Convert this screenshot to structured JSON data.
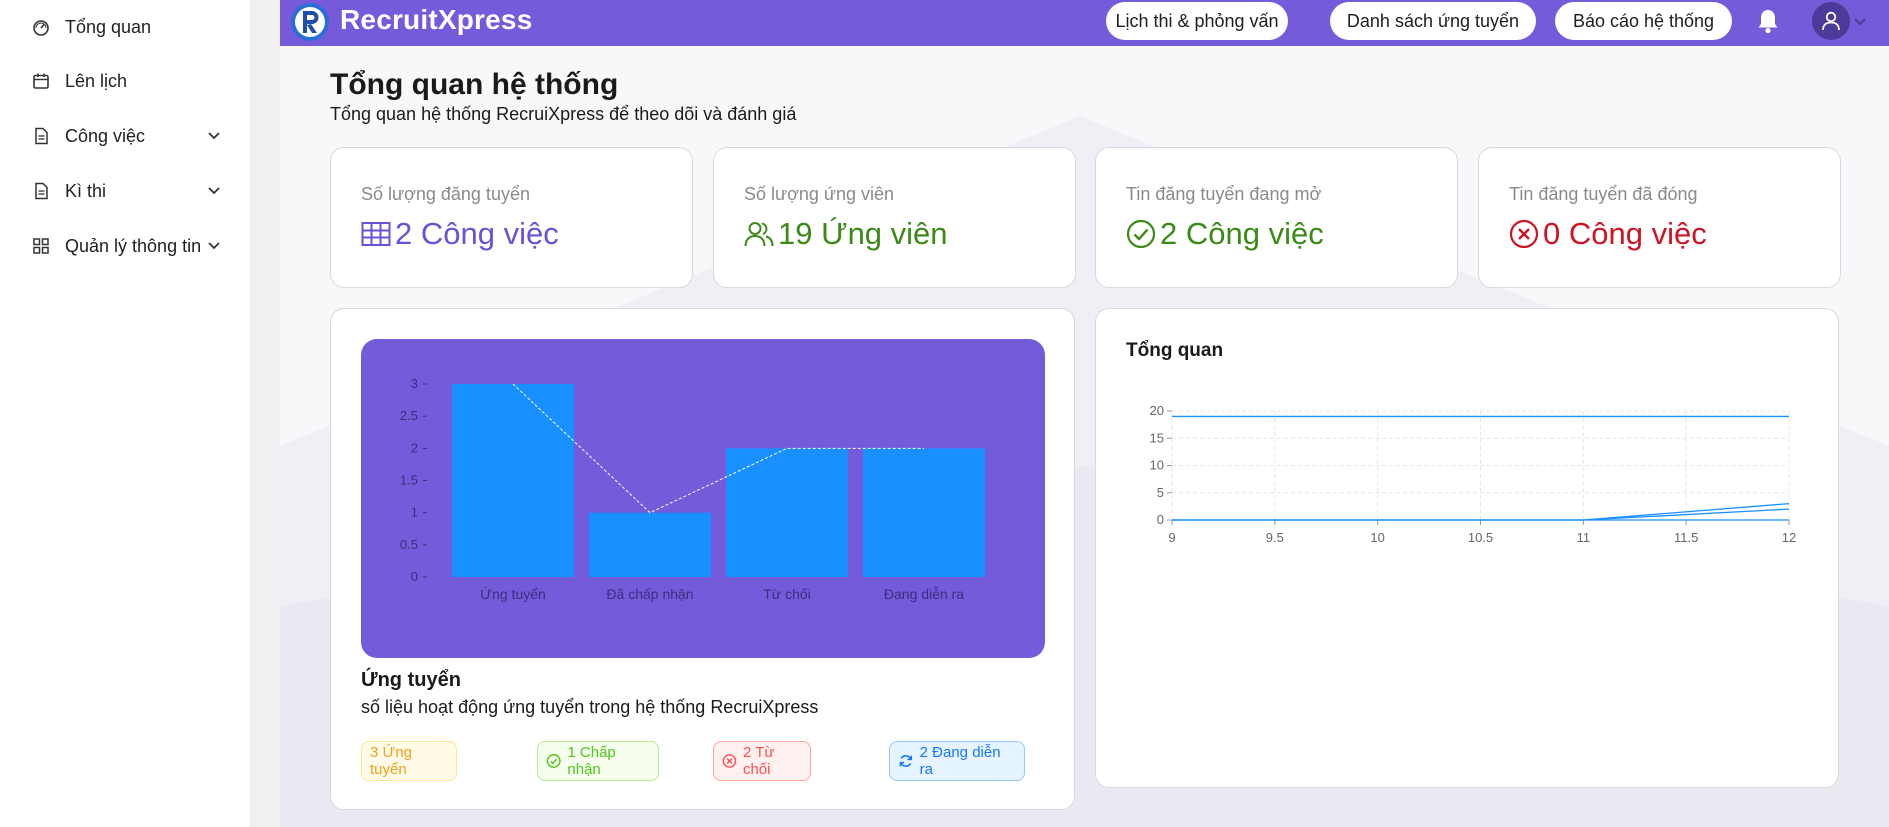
{
  "app": {
    "brand": "RecruitXpress"
  },
  "sidebar": {
    "items": [
      {
        "label": "Tổng quan",
        "icon": "dashboard-icon",
        "has_submenu": false
      },
      {
        "label": "Lên lịch",
        "icon": "calendar-icon",
        "has_submenu": false
      },
      {
        "label": "Công việc",
        "icon": "document-icon",
        "has_submenu": true
      },
      {
        "label": "Kì thi",
        "icon": "document-icon",
        "has_submenu": true
      },
      {
        "label": "Quản lý thông tin",
        "icon": "grid-icon",
        "has_submenu": true
      }
    ]
  },
  "header": {
    "nav": [
      "Lịch thi & phỏng vấn",
      "Danh sách ứng tuyển",
      "Báo cáo hệ thống"
    ],
    "icons": [
      "bell-icon",
      "user-icon",
      "chevron-down-icon"
    ]
  },
  "page": {
    "title": "Tổng quan hệ thống",
    "subtitle": "Tổng quan hệ thống RecruiXpress để theo dõi và đánh giá"
  },
  "stats": [
    {
      "label": "Số lượng đăng tuyển",
      "value": "2 Công việc",
      "icon": "table-icon",
      "color": "#6a51d6"
    },
    {
      "label": "Số lượng ứng viên",
      "value": "19 Ứng viên",
      "icon": "users-icon",
      "color": "#3b8a17"
    },
    {
      "label": "Tin đăng tuyển đang mở",
      "value": "2 Công việc",
      "icon": "check-circle-icon",
      "color": "#3b8a17"
    },
    {
      "label": "Tin đăng tuyển đã đóng",
      "value": "0 Công việc",
      "icon": "close-circle-icon",
      "color": "#cf1322"
    }
  ],
  "application_card": {
    "title": "Ứng tuyển",
    "subtitle": "số liệu hoạt động ứng tuyển trong hệ thống RecruiXpress",
    "tags": [
      {
        "label": "3 Ứng tuyển",
        "icon": "",
        "color": "#f0a020"
      },
      {
        "label": "1 Chấp nhận",
        "icon": "check-circle-icon",
        "color": "#52c41a"
      },
      {
        "label": "2 Từ chối",
        "icon": "close-circle-icon",
        "color": "#ff4d4f"
      },
      {
        "label": "2 Đang diễn ra",
        "icon": "sync-icon",
        "color": "#1677ff"
      }
    ]
  },
  "overview_card": {
    "title": "Tổng quan"
  },
  "chart_data": [
    {
      "type": "bar",
      "categories": [
        "Ứng tuyển",
        "Đã chấp nhận",
        "Từ chối",
        "Đang diễn ra"
      ],
      "values": [
        3,
        1,
        2,
        2
      ],
      "overlay_line": [
        3,
        1,
        2,
        2
      ],
      "ylim": [
        0,
        3
      ],
      "yticks": [
        "0",
        "0.5",
        "1",
        "1.5",
        "2",
        "2.5",
        "3"
      ],
      "bar_color": "#1890ff",
      "background": "#745bd9"
    },
    {
      "type": "line",
      "title": "Tổng quan",
      "x": [
        9,
        9.5,
        10,
        10.5,
        11,
        11.5,
        12
      ],
      "xticks": [
        "9",
        "9.5",
        "10",
        "10.5",
        "11",
        "11.5",
        "12"
      ],
      "yticks": [
        "0",
        "5",
        "10",
        "15",
        "20"
      ],
      "ylim": [
        0,
        20
      ],
      "xlim": [
        9,
        12
      ],
      "grid": true,
      "series": [
        {
          "x": [
            9,
            12
          ],
          "values": [
            19,
            19
          ]
        },
        {
          "x": [
            9,
            11,
            12
          ],
          "values": [
            0,
            0,
            3
          ]
        },
        {
          "x": [
            9,
            11,
            12
          ],
          "values": [
            0,
            0,
            2
          ]
        }
      ],
      "line_color": "#1890ff"
    }
  ]
}
